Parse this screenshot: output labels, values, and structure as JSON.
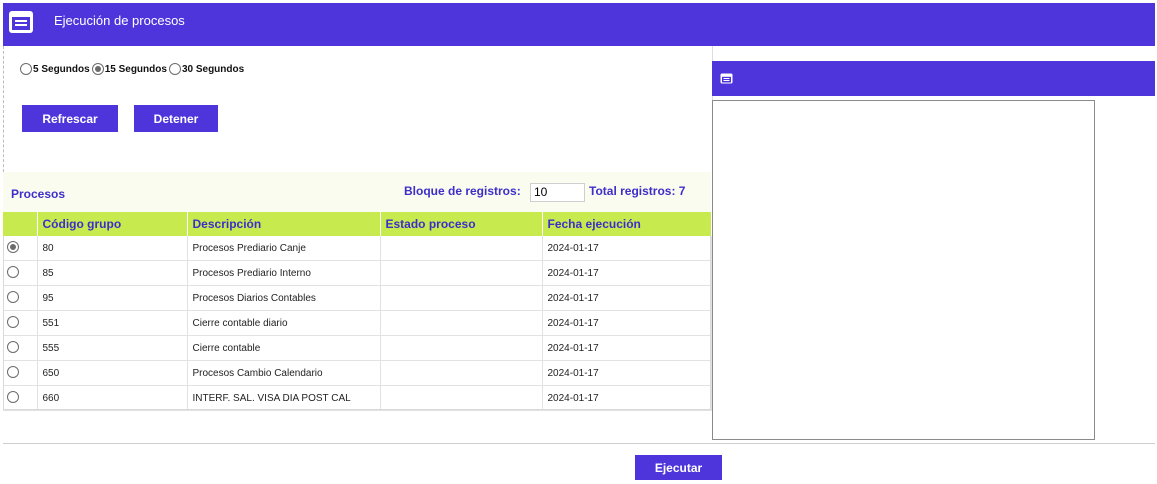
{
  "header": {
    "title": "Ejecución de procesos",
    "icon": "window-list-icon",
    "color": "#4e35db"
  },
  "refresh_options": [
    {
      "label": "5 Segundos",
      "selected": false
    },
    {
      "label": "15 Segundos",
      "selected": true
    },
    {
      "label": "30 Segundos",
      "selected": false
    }
  ],
  "buttons": {
    "refresh": "Refrescar",
    "stop": "Detener",
    "execute": "Ejecutar"
  },
  "grid": {
    "title": "Procesos",
    "block_label": "Bloque de registros:",
    "block_value": "10",
    "total_label": "Total registros: 7",
    "columns": [
      "",
      "Código grupo",
      "Descripción",
      "Estado proceso",
      "Fecha ejecución"
    ],
    "rows": [
      {
        "selected": true,
        "code": "80",
        "description": "Procesos Prediario Canje",
        "status": "",
        "date": "2024-01-17"
      },
      {
        "selected": false,
        "code": "85",
        "description": "Procesos Prediario Interno",
        "status": "",
        "date": "2024-01-17"
      },
      {
        "selected": false,
        "code": "95",
        "description": "Procesos Diarios Contables",
        "status": "",
        "date": "2024-01-17"
      },
      {
        "selected": false,
        "code": "551",
        "description": "Cierre contable diario",
        "status": "",
        "date": "2024-01-17"
      },
      {
        "selected": false,
        "code": "555",
        "description": "Cierre contable",
        "status": "",
        "date": "2024-01-17"
      },
      {
        "selected": false,
        "code": "650",
        "description": "Procesos Cambio Calendario",
        "status": "",
        "date": "2024-01-17"
      },
      {
        "selected": false,
        "code": "660",
        "description": "INTERF. SAL. VISA DIA POST CAL",
        "status": "",
        "date": "2024-01-17"
      }
    ]
  },
  "log_panel": {
    "icon": "window-list-icon",
    "content": ""
  }
}
